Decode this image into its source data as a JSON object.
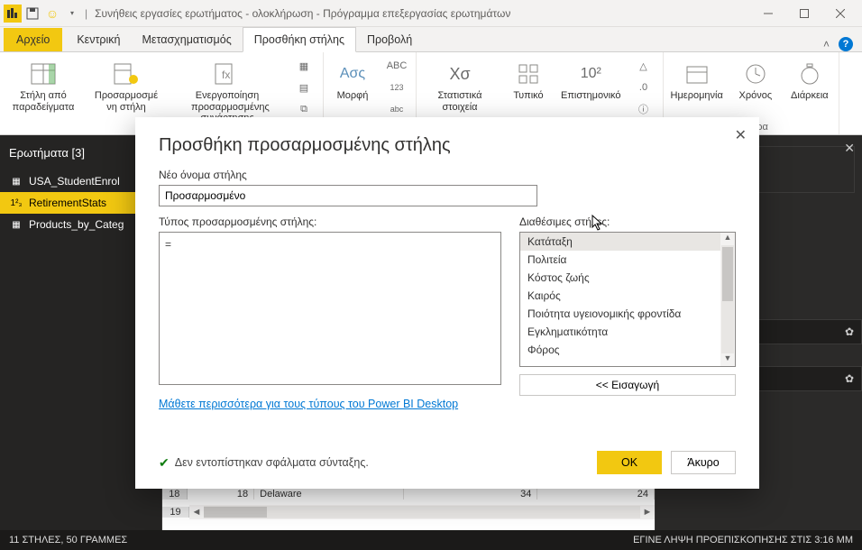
{
  "titlebar": {
    "title": "Συνήθεις εργασίες ερωτήματος - ολοκλήρωση - Πρόγραμμα επεξεργασίας ερωτημάτων"
  },
  "ribbon": {
    "file": "Αρχείο",
    "tabs": [
      "Κεντρική",
      "Μετασχηματισμός",
      "Προσθήκη στήλης",
      "Προβολή"
    ],
    "active_tab_index": 2,
    "btn_examples": "Στήλη από παραδείγματα",
    "btn_custom": "Προσαρμοσμέ νη στήλη",
    "btn_invoke": "Ενεργοποίηση προσαρμοσμένης συνάρτησης",
    "btn_format": "Μορφή",
    "btn_stats": "Στατιστικά στοιχεία",
    "btn_standard": "Τυπικό",
    "btn_scientific": "Επιστημονικό",
    "btn_date": "Ημερομηνία",
    "btn_time": "Χρόνος",
    "btn_duration": "Διάρκεια",
    "group_datetime": "και ώρα"
  },
  "queries": {
    "header": "Ερωτήματα [3]",
    "items": [
      "USA_StudentEnrol",
      "RetirementStats",
      "Products_by_Categ"
    ],
    "selected_index": 1
  },
  "table": {
    "row18": {
      "num": "18",
      "c1": "18",
      "c2": "Delaware",
      "c3": "34",
      "c4": "24"
    },
    "row19_num": "19"
  },
  "modal": {
    "title": "Προσθήκη προσαρμοσμένης στήλης",
    "new_col_label": "Νέο όνομα στήλης",
    "new_col_value": "Προσαρμοσμένο",
    "formula_label": "Τύπος προσαρμοσμένης στήλης:",
    "formula_value": "=",
    "available_label": "Διαθέσιμες στήλες:",
    "columns": [
      "Κατάταξη",
      "Πολιτεία",
      "Κόστος ζωής",
      "Καιρός",
      "Ποιότητα υγειονομικής φροντίδα",
      "Εγκληματικότητα",
      "Φόρος"
    ],
    "insert_label": "<< Εισαγωγή",
    "learn_more": "Μάθετε περισσότερα για τους τύπους του Power BI Desktop",
    "status": "Δεν εντοπίστηκαν σφάλματα σύνταξης.",
    "ok": "OK",
    "cancel": "Άκυρο"
  },
  "statusbar": {
    "left": "11 ΣΤΗΛΕΣ, 50 ΓΡΑΜΜΕΣ",
    "right": "ΕΓΙΝΕ ΛΗΨΗ ΠΡΟΕΠΙΣΚΟΠΗΣΗΣ ΣΤΙΣ 3:16 ΜΜ"
  }
}
